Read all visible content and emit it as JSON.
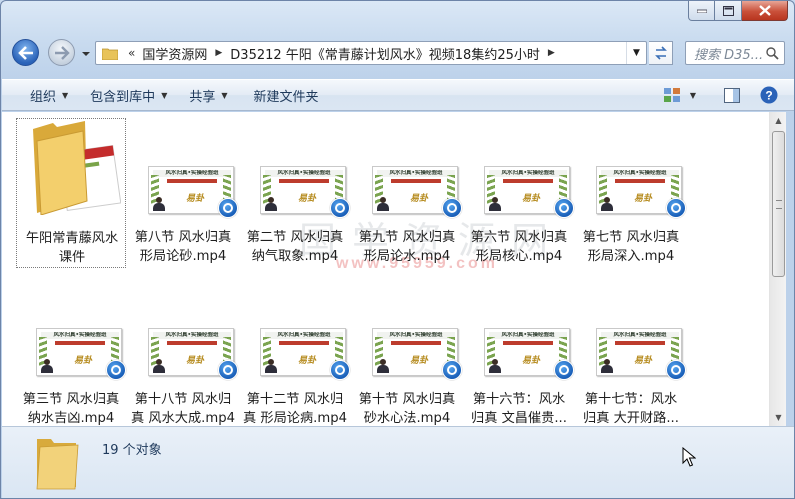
{
  "window": {
    "colors": {
      "close": "#c9503a",
      "accent": "#2a62b8"
    }
  },
  "address": {
    "overflow": "«",
    "segments": [
      "国学资源网",
      "D35212 午阳《常青藤计划风水》视频18集约25小时"
    ],
    "search_placeholder": "搜索 D35..."
  },
  "toolbar": {
    "organize": "组织",
    "include_library": "包含到库中",
    "share": "共享",
    "new_folder": "新建文件夹"
  },
  "items": [
    {
      "name_line1": "午阳常青藤风水",
      "name_line2": "课件",
      "type": "folder"
    },
    {
      "name_line1": "第八节 风水归真",
      "name_line2": "形局论砂.mp4",
      "type": "video"
    },
    {
      "name_line1": "第二节 风水归真",
      "name_line2": "纳气取象.mp4",
      "type": "video"
    },
    {
      "name_line1": "第九节 风水归真",
      "name_line2": "形局论水.mp4",
      "type": "video"
    },
    {
      "name_line1": "第六节 风水归真",
      "name_line2": "形局核心.mp4",
      "type": "video"
    },
    {
      "name_line1": "第七节 风水归真",
      "name_line2": "形局深入.mp4",
      "type": "video"
    },
    {
      "name_line1": "第三节 风水归真",
      "name_line2": "纳水吉凶.mp4",
      "type": "video"
    },
    {
      "name_line1": "第十八节 风水归",
      "name_line2": "真 风水大成.mp4",
      "type": "video"
    },
    {
      "name_line1": "第十二节 风水归",
      "name_line2": "真 形局论病.mp4",
      "type": "video"
    },
    {
      "name_line1": "第十节 风水归真",
      "name_line2": "砂水心法.mp4",
      "type": "video"
    },
    {
      "name_line1": "第十六节：风水",
      "name_line2": "归真 文昌催贵...",
      "type": "video"
    },
    {
      "name_line1": "第十七节：风水",
      "name_line2": "归真 大开财路...",
      "type": "video"
    }
  ],
  "thumbnail": {
    "title": "风水归真•实操经验班",
    "brand": "易卦"
  },
  "watermark": {
    "text": "国学资源网",
    "url": "www.95959.com"
  },
  "details": {
    "count": "19 个对象"
  }
}
